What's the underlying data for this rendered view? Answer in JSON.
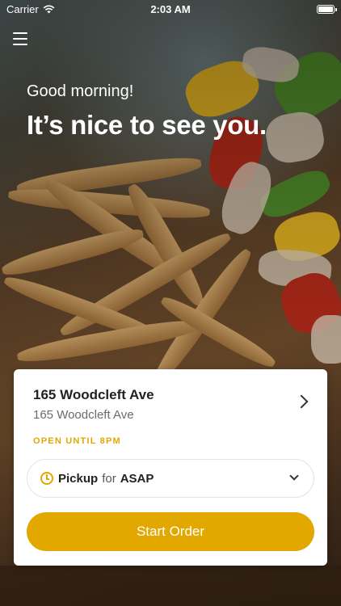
{
  "status_bar": {
    "carrier": "Carrier",
    "time": "2:03 AM"
  },
  "header": {
    "greeting": "Good morning!",
    "headline": "It’s nice to see you."
  },
  "location_card": {
    "name": "165 Woodcleft Ave",
    "address": "165 Woodcleft Ave",
    "open_status": "OPEN UNTIL 8PM",
    "pickup": {
      "mode": "Pickup",
      "connector": "for",
      "time": "ASAP"
    },
    "start_button": "Start Order"
  },
  "colors": {
    "accent": "#e2a800",
    "card_bg": "#ffffff",
    "text_dark": "#222222",
    "text_muted": "#6b6b6b"
  },
  "icons": {
    "menu": "hamburger-menu-icon",
    "wifi": "wifi-icon",
    "battery": "battery-icon",
    "location_chevron": "chevron-right-icon",
    "clock": "clock-icon",
    "dropdown": "chevron-down-icon"
  }
}
